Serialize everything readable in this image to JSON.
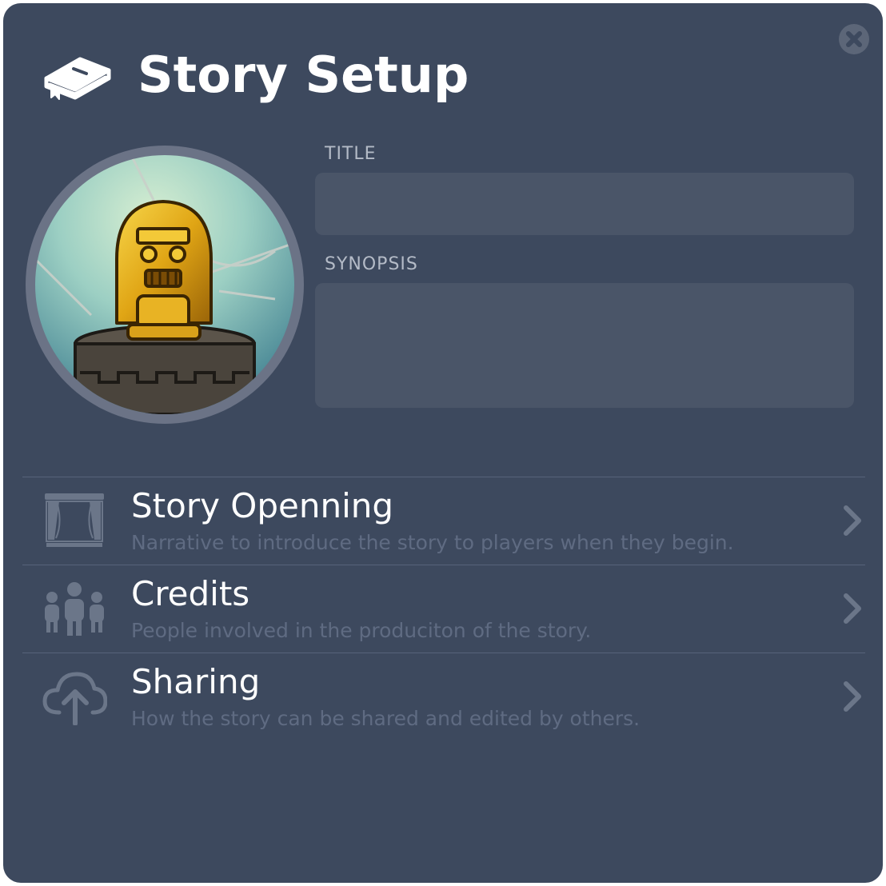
{
  "dialog": {
    "title": "Story Setup",
    "icon": "book-icon",
    "close_icon": "close-icon"
  },
  "cover_image": {
    "icon": "golden-idol-illustration"
  },
  "form": {
    "title_label": "TITLE",
    "title_value": "",
    "synopsis_label": "SYNOPSIS",
    "synopsis_value": ""
  },
  "menu": {
    "items": [
      {
        "icon": "theater-stage-icon",
        "label": "Story Openning",
        "description": "Narrative to introduce the story to players when they begin."
      },
      {
        "icon": "people-group-icon",
        "label": "Credits",
        "description": "People involved in the produciton of the story."
      },
      {
        "icon": "cloud-upload-icon",
        "label": "Sharing",
        "description": "How the story can be shared and edited by others."
      }
    ],
    "chevron_icon": "chevron-right-icon"
  },
  "colors": {
    "panel_bg": "#3d495e",
    "input_bg": "#4a5568",
    "icon_muted": "#6b7689",
    "description_text": "#5f6b82"
  }
}
